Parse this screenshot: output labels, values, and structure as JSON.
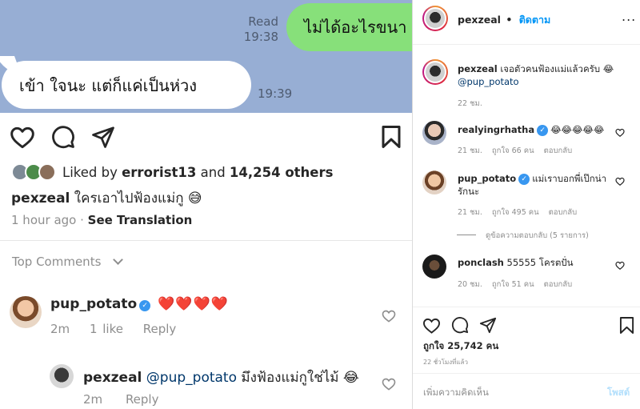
{
  "chat": {
    "outgoing_text": "ไม่ได้อะไรขนา",
    "read_label": "Read",
    "outgoing_time": "19:38",
    "incoming_text": "เข้า ใจนะ แต่ก็แค่เป็นห่วง",
    "incoming_time": "19:39"
  },
  "mobile_post": {
    "liked_by_prefix": "Liked by",
    "liked_by_user": "errorist13",
    "and_label": "and",
    "others": "14,254 others",
    "caption_user": "pexzeal",
    "caption_text": "ใครเอาไปฟ้องแม่กู 😅",
    "time_ago": "1 hour ago",
    "separator": "·",
    "see_translation": "See Translation",
    "top_comments": "Top Comments",
    "comments": [
      {
        "user": "pup_potato",
        "verified": true,
        "text": "❤️❤️❤️❤️",
        "time": "2m",
        "likes": "1 like",
        "reply": "Reply"
      },
      {
        "user": "pexzeal",
        "mention": "@pup_potato",
        "text": "มึงฟ้องแม่กูใช่ไม้ 😂",
        "time": "2m",
        "reply": "Reply"
      }
    ]
  },
  "desktop_post": {
    "username": "pexzeal",
    "separator": "•",
    "follow_label": "ติดตาม",
    "more_label": "...",
    "caption": {
      "user": "pexzeal",
      "text": "เจอตัวคนฟ้องแม่แล้วครับ 😂",
      "mention": "@pup_potato",
      "time": "22 ชม."
    },
    "comments": [
      {
        "user": "realyingrhatha",
        "verified": true,
        "text": "😂😂😂😂😂",
        "time": "21 ชม.",
        "likes": "ถูกใจ 66 คน",
        "reply": "ตอบกลับ"
      },
      {
        "user": "pup_potato",
        "verified": true,
        "text": "แม่เราบอกพี่เป๊กน่ารักนะ",
        "time": "21 ชม.",
        "likes": "ถูกใจ 495 คน",
        "reply": "ตอบกลับ"
      },
      {
        "user": "ponclash",
        "verified": false,
        "text": "55555 โครตปั่น",
        "time": "20 ชม.",
        "likes": "ถูกใจ 51 คน",
        "reply": "ตอบกลับ"
      }
    ],
    "view_replies": "ดูข้อความตอบกลับ (5 รายการ)",
    "likes_total": "ถูกใจ 25,742 คน",
    "posted_time": "22 ชั่วโมงที่แล้ว",
    "add_comment_placeholder": "เพิ่มความคิดเห็น",
    "post_button": "โพสต์"
  }
}
